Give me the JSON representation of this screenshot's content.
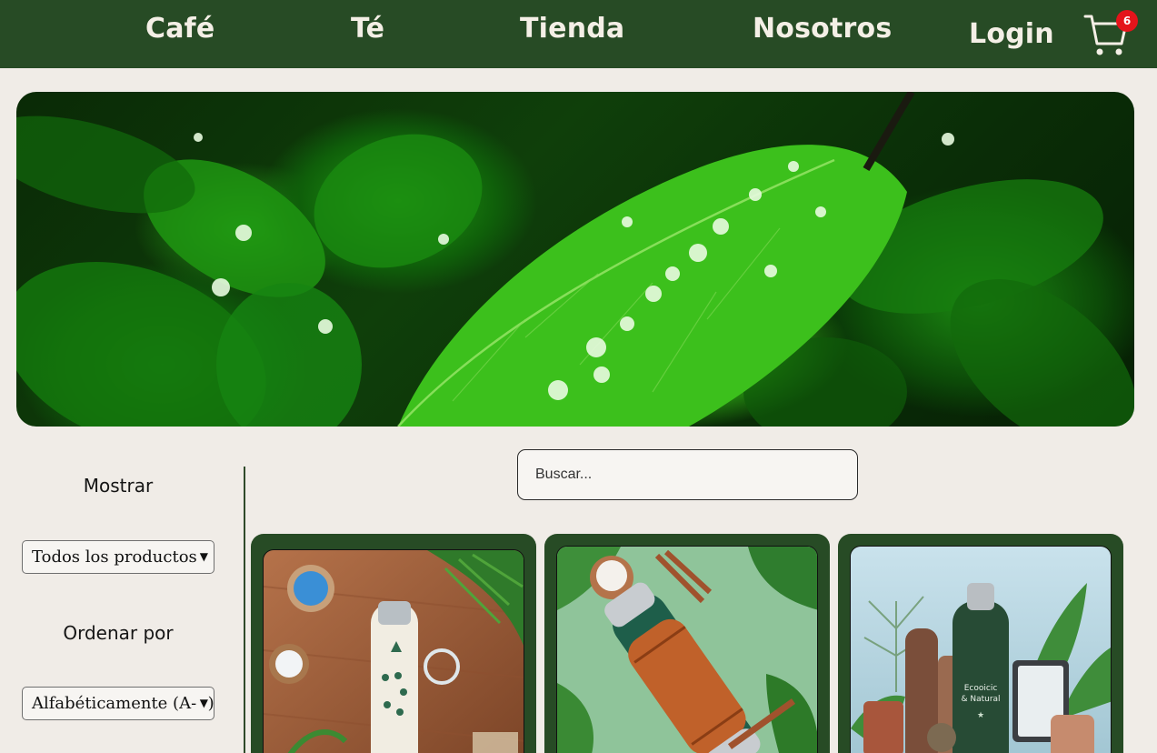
{
  "nav": {
    "items": [
      "Café",
      "Té",
      "Tienda",
      "Nosotros"
    ],
    "login": "Login",
    "cart_count": "6",
    "bg_color": "#274b25"
  },
  "sidebar": {
    "show_label": "Mostrar",
    "show_select": "Todos los productos",
    "sort_label": "Ordenar por",
    "sort_select": "Alfabéticamente (A-Z)"
  },
  "search": {
    "placeholder": "Buscar..."
  },
  "products": [
    {
      "image": "white-bottle-wood-table"
    },
    {
      "image": "leather-wrapped-bottle-green"
    },
    {
      "image": "green-bottle-plants",
      "label_line1": "Ecooicic",
      "label_line2": "& Natural"
    }
  ]
}
